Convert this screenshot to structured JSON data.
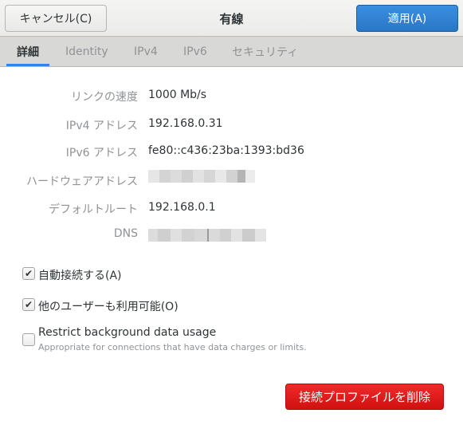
{
  "header": {
    "title": "有線",
    "cancel_label": "キャンセル(C)",
    "apply_label": "適用(A)"
  },
  "tabs": [
    {
      "label": "詳細",
      "active": true
    },
    {
      "label": "Identity",
      "active": false
    },
    {
      "label": "IPv4",
      "active": false
    },
    {
      "label": "IPv6",
      "active": false
    },
    {
      "label": "セキュリティ",
      "active": false
    }
  ],
  "details": {
    "link_speed": {
      "label": "リンクの速度",
      "value": "1000 Mb/s"
    },
    "ipv4": {
      "label": "IPv4 アドレス",
      "value": "192.168.0.31"
    },
    "ipv6": {
      "label": "IPv6 アドレス",
      "value": "fe80::c436:23ba:1393:bd36"
    },
    "hardware": {
      "label": "ハードウェアアドレス",
      "value": "[redacted]"
    },
    "default_route": {
      "label": "デフォルトルート",
      "value": "192.168.0.1"
    },
    "dns": {
      "label": "DNS",
      "value": "[redacted]"
    }
  },
  "options": {
    "auto_connect": {
      "label": "自動接続する(A)",
      "checked": true
    },
    "all_users": {
      "label": "他のユーザーも利用可能(O)",
      "checked": true
    },
    "restrict_bg": {
      "label": "Restrict background data usage",
      "sublabel": "Appropriate for connections that have data charges or limits.",
      "checked": false
    }
  },
  "footer": {
    "delete_label": "接続プロファイルを削除"
  },
  "icons": {
    "checkmark": "✔"
  }
}
